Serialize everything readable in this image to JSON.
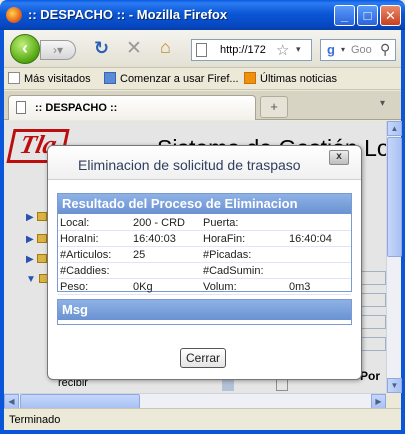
{
  "window": {
    "title": ":: DESPACHO :: - Mozilla Firefox",
    "minimize": "_",
    "maximize": "□",
    "close": "✕"
  },
  "toolbar": {
    "url": "http://172",
    "search_placeholder": "Goo",
    "icons": [
      "back-icon",
      "forward-icon",
      "reload-icon",
      "stop-icon",
      "home-icon",
      "page-icon",
      "star-icon",
      "google-icon",
      "search-icon"
    ]
  },
  "bookmarks": {
    "items": [
      "Más visitados",
      "Comenzar a usar Firef...",
      "Últimas noticias"
    ]
  },
  "tabs": {
    "active_title": ":: DESPACHO ::",
    "new_tab": "+"
  },
  "page": {
    "logo": "Tla",
    "system_name": "Sistema de Gestión Log",
    "recibir": "recibir",
    "por": "Por"
  },
  "dialog": {
    "title": "Eliminacion de solicitud de traspaso",
    "close": "x",
    "result_header": "Resultado del Proceso de Eliminacion",
    "rows": [
      {
        "l1": "Local:",
        "v1": "200 - CRD",
        "l2": "Puerta:",
        "v2": ""
      },
      {
        "l1": "HoraIni:",
        "v1": "16:40:03",
        "l2": "HoraFin:",
        "v2": "16:40:04"
      },
      {
        "l1": "#Articulos:",
        "v1": "25",
        "l2": "#Picadas:",
        "v2": ""
      },
      {
        "l1": "#Caddies:",
        "v1": "",
        "l2": "#CadSumin:",
        "v2": ""
      },
      {
        "l1": "Peso:",
        "v1": "0Kg",
        "l2": "Volum:",
        "v2": "0m3"
      }
    ],
    "msg_header": "Msg",
    "close_button": "Cerrar"
  },
  "status": {
    "text": "Terminado"
  }
}
